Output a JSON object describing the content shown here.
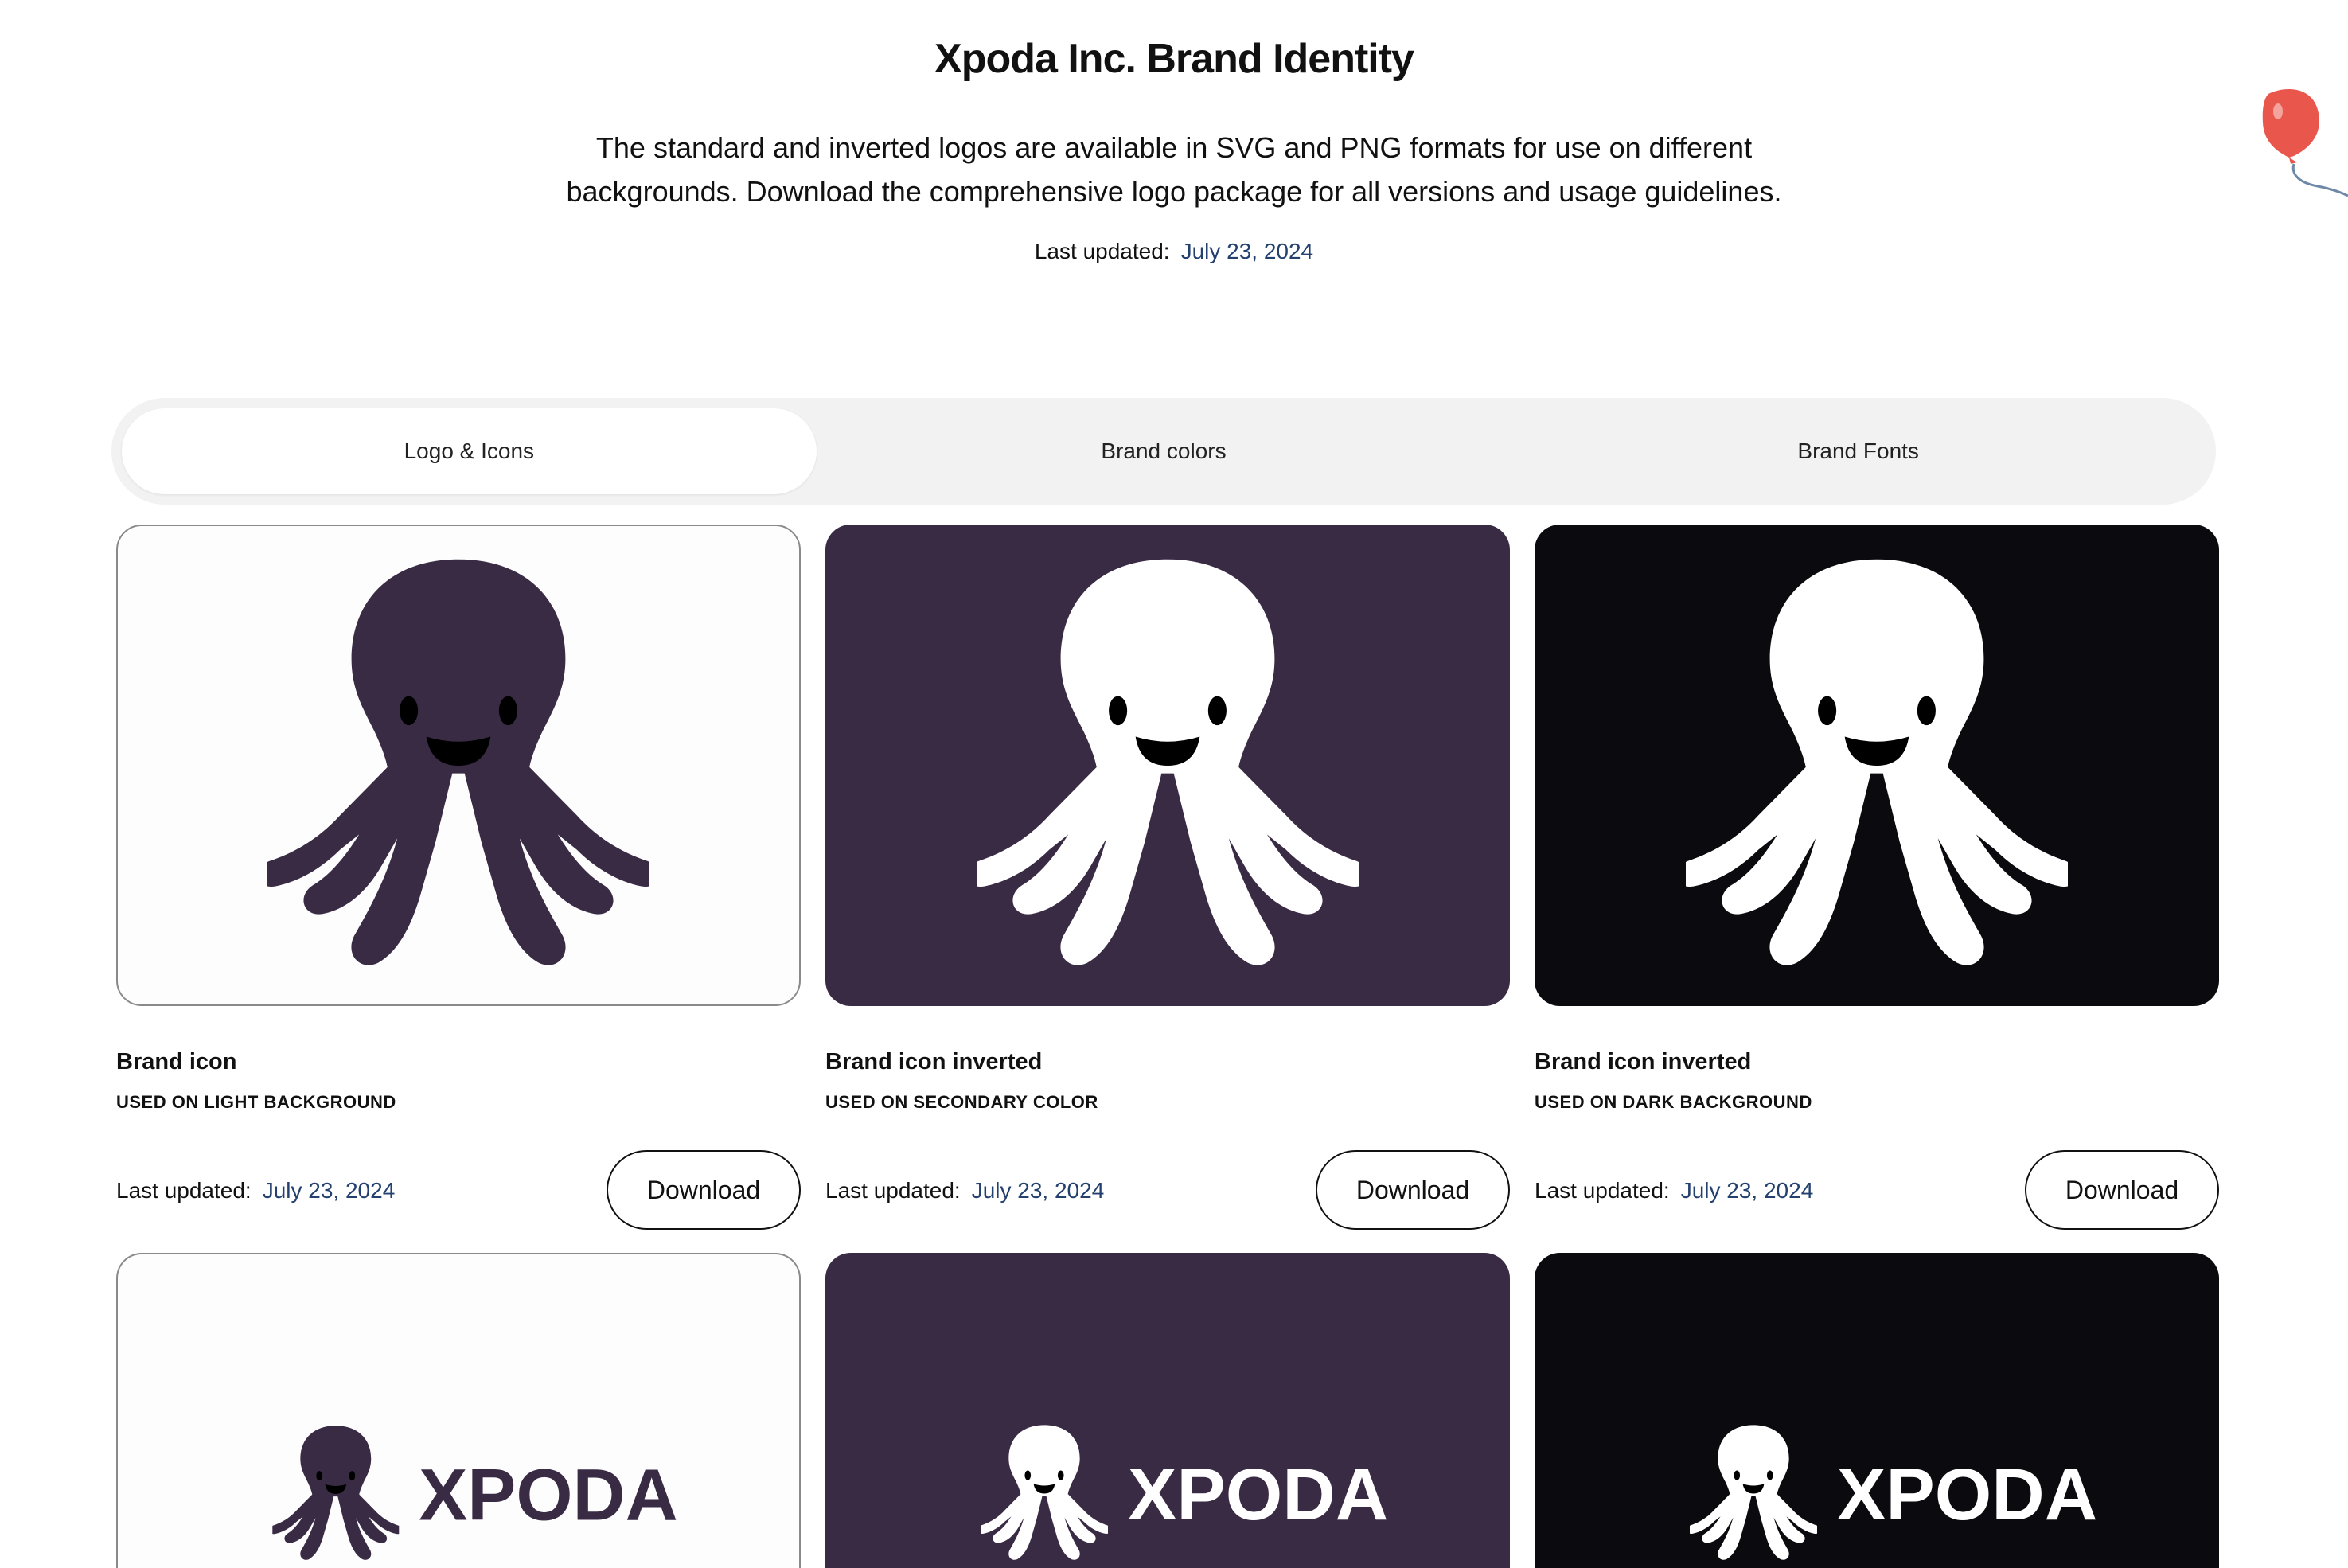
{
  "header": {
    "title": "Xpoda Inc.  Brand Identity",
    "description": "The standard and inverted logos are available in SVG and PNG formats for use on different backgrounds. Download the comprehensive logo package for all versions and usage guidelines.",
    "updated_label": "Last updated:",
    "updated_date": "July 23, 2024"
  },
  "tabs": [
    {
      "label": "Logo & Icons",
      "active": true
    },
    {
      "label": "Brand colors",
      "active": false
    },
    {
      "label": "Brand Fonts",
      "active": false
    }
  ],
  "colors": {
    "secondary": "#3a2b45",
    "dark": "#0b0a0e",
    "light": "#fdfdfe",
    "date": "#23406e",
    "balloon": "#e8564c"
  },
  "cards": [
    {
      "title": "Brand icon",
      "subtitle": "USED ON LIGHT BACKGROUND",
      "updated_label": "Last updated:",
      "updated_date": "July 23, 2024",
      "button": "Download"
    },
    {
      "title": "Brand icon inverted",
      "subtitle": "USED ON SECONDARY COLOR",
      "updated_label": "Last updated:",
      "updated_date": "July 23, 2024",
      "button": "Download"
    },
    {
      "title": "Brand icon inverted",
      "subtitle": "USED ON DARK BACKGROUND",
      "updated_label": "Last updated:",
      "updated_date": "July 23, 2024",
      "button": "Download"
    }
  ],
  "logos": [
    {
      "wordmark": "XPODA"
    },
    {
      "wordmark": "XPODA"
    },
    {
      "wordmark": "XPODA"
    }
  ],
  "icons": {
    "octopus": "octopus-icon",
    "balloon": "balloon-icon"
  }
}
